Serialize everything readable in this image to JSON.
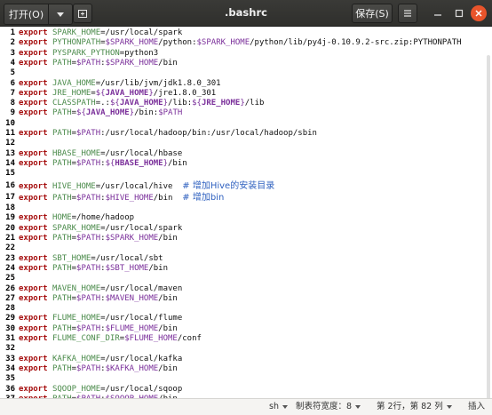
{
  "header": {
    "open_label": "打开(O)",
    "title": ".bashrc",
    "save_label": "保存(S)"
  },
  "status": {
    "language": "sh",
    "tab_width": "制表符宽度：8",
    "position": "第 2行，第 82 列",
    "mode": "插入"
  },
  "colors": {
    "keyword": "#a50d0d",
    "variable": "#4a8a4a",
    "expansion": "#7a2f9a",
    "comment": "#2d5fbf",
    "close_button": "#e9542b"
  },
  "lines": [
    {
      "n": "1",
      "parts": [
        [
          "kw",
          "export"
        ],
        [
          "plain",
          " "
        ],
        [
          "var",
          "SPARK_HOME"
        ],
        [
          "plain",
          "=/usr/local/spark"
        ]
      ]
    },
    {
      "n": "2",
      "parts": [
        [
          "kw",
          "export"
        ],
        [
          "plain",
          " "
        ],
        [
          "var",
          "PYTHONPATH"
        ],
        [
          "plain",
          "="
        ],
        [
          "exp",
          "$SPARK_HOME"
        ],
        [
          "plain",
          "/python:"
        ],
        [
          "exp",
          "$SPARK_HOME"
        ],
        [
          "plain",
          "/python/lib/py4j-0.10.9.2-src.zip:PYTHONPATH"
        ]
      ]
    },
    {
      "n": "3",
      "parts": [
        [
          "kw",
          "export"
        ],
        [
          "plain",
          " "
        ],
        [
          "var",
          "PYSPARK_PYTHON"
        ],
        [
          "plain",
          "=python3"
        ]
      ]
    },
    {
      "n": "4",
      "parts": [
        [
          "kw",
          "export"
        ],
        [
          "plain",
          " "
        ],
        [
          "var",
          "PATH"
        ],
        [
          "plain",
          "="
        ],
        [
          "exp",
          "$PATH"
        ],
        [
          "plain",
          ":"
        ],
        [
          "exp",
          "$SPARK_HOME"
        ],
        [
          "plain",
          "/bin"
        ]
      ]
    },
    {
      "n": "5",
      "parts": []
    },
    {
      "n": "6",
      "parts": [
        [
          "kw",
          "export"
        ],
        [
          "plain",
          " "
        ],
        [
          "var",
          "JAVA_HOME"
        ],
        [
          "plain",
          "=/usr/lib/jvm/jdk1.8.0_301"
        ]
      ]
    },
    {
      "n": "7",
      "parts": [
        [
          "kw",
          "export"
        ],
        [
          "plain",
          " "
        ],
        [
          "var",
          "JRE_HOME"
        ],
        [
          "plain",
          "="
        ],
        [
          "exp",
          "${"
        ],
        [
          "expb",
          "JAVA_HOME"
        ],
        [
          "exp",
          "}"
        ],
        [
          "plain",
          "/jre1.8.0_301"
        ]
      ]
    },
    {
      "n": "8",
      "parts": [
        [
          "kw",
          "export"
        ],
        [
          "plain",
          " "
        ],
        [
          "var",
          "CLASSPATH"
        ],
        [
          "plain",
          "=.:"
        ],
        [
          "exp",
          "${"
        ],
        [
          "expb",
          "JAVA_HOME"
        ],
        [
          "exp",
          "}"
        ],
        [
          "plain",
          "/lib:"
        ],
        [
          "exp",
          "${"
        ],
        [
          "expb",
          "JRE_HOME"
        ],
        [
          "exp",
          "}"
        ],
        [
          "plain",
          "/lib"
        ]
      ]
    },
    {
      "n": "9",
      "parts": [
        [
          "kw",
          "export"
        ],
        [
          "plain",
          " "
        ],
        [
          "var",
          "PATH"
        ],
        [
          "plain",
          "="
        ],
        [
          "exp",
          "${"
        ],
        [
          "expb",
          "JAVA_HOME"
        ],
        [
          "exp",
          "}"
        ],
        [
          "plain",
          "/bin:"
        ],
        [
          "exp",
          "$PATH"
        ]
      ]
    },
    {
      "n": "10",
      "parts": []
    },
    {
      "n": "11",
      "parts": [
        [
          "kw",
          "export"
        ],
        [
          "plain",
          " "
        ],
        [
          "var",
          "PATH"
        ],
        [
          "plain",
          "="
        ],
        [
          "exp",
          "$PATH"
        ],
        [
          "plain",
          ":/usr/local/hadoop/bin:/usr/local/hadoop/sbin"
        ]
      ]
    },
    {
      "n": "12",
      "parts": []
    },
    {
      "n": "13",
      "parts": [
        [
          "kw",
          "export"
        ],
        [
          "plain",
          " "
        ],
        [
          "var",
          "HBASE_HOME"
        ],
        [
          "plain",
          "=/usr/local/hbase"
        ]
      ]
    },
    {
      "n": "14",
      "parts": [
        [
          "kw",
          "export"
        ],
        [
          "plain",
          " "
        ],
        [
          "var",
          "PATH"
        ],
        [
          "plain",
          "="
        ],
        [
          "exp",
          "$PATH"
        ],
        [
          "plain",
          ":"
        ],
        [
          "exp",
          "${"
        ],
        [
          "expb",
          "HBASE_HOME"
        ],
        [
          "exp",
          "}"
        ],
        [
          "plain",
          "/bin"
        ]
      ]
    },
    {
      "n": "15",
      "parts": []
    },
    {
      "n": "16",
      "parts": [
        [
          "kw",
          "export"
        ],
        [
          "plain",
          " "
        ],
        [
          "var",
          "HIVE_HOME"
        ],
        [
          "plain",
          "=/usr/local/hive  "
        ],
        [
          "comment",
          "# 增加Hive的安装目录"
        ]
      ]
    },
    {
      "n": "17",
      "parts": [
        [
          "kw",
          "export"
        ],
        [
          "plain",
          " "
        ],
        [
          "var",
          "PATH"
        ],
        [
          "plain",
          "="
        ],
        [
          "exp",
          "$PATH"
        ],
        [
          "plain",
          ":"
        ],
        [
          "exp",
          "$HIVE_HOME"
        ],
        [
          "plain",
          "/bin  "
        ],
        [
          "comment",
          "# 增加bin"
        ]
      ]
    },
    {
      "n": "18",
      "parts": []
    },
    {
      "n": "19",
      "parts": [
        [
          "kw",
          "export"
        ],
        [
          "plain",
          " "
        ],
        [
          "var",
          "HOME"
        ],
        [
          "plain",
          "=/home/hadoop"
        ]
      ]
    },
    {
      "n": "20",
      "parts": [
        [
          "kw",
          "export"
        ],
        [
          "plain",
          " "
        ],
        [
          "var",
          "SPARK_HOME"
        ],
        [
          "plain",
          "=/usr/local/spark"
        ]
      ]
    },
    {
      "n": "21",
      "parts": [
        [
          "kw",
          "export"
        ],
        [
          "plain",
          " "
        ],
        [
          "var",
          "PATH"
        ],
        [
          "plain",
          "="
        ],
        [
          "exp",
          "$PATH"
        ],
        [
          "plain",
          ":"
        ],
        [
          "exp",
          "$SPARK_HOME"
        ],
        [
          "plain",
          "/bin"
        ]
      ]
    },
    {
      "n": "22",
      "parts": []
    },
    {
      "n": "23",
      "parts": [
        [
          "kw",
          "export"
        ],
        [
          "plain",
          " "
        ],
        [
          "var",
          "SBT_HOME"
        ],
        [
          "plain",
          "=/usr/local/sbt"
        ]
      ]
    },
    {
      "n": "24",
      "parts": [
        [
          "kw",
          "export"
        ],
        [
          "plain",
          " "
        ],
        [
          "var",
          "PATH"
        ],
        [
          "plain",
          "="
        ],
        [
          "exp",
          "$PATH"
        ],
        [
          "plain",
          ":"
        ],
        [
          "exp",
          "$SBT_HOME"
        ],
        [
          "plain",
          "/bin"
        ]
      ]
    },
    {
      "n": "25",
      "parts": []
    },
    {
      "n": "26",
      "parts": [
        [
          "kw",
          "export"
        ],
        [
          "plain",
          " "
        ],
        [
          "var",
          "MAVEN_HOME"
        ],
        [
          "plain",
          "=/usr/local/maven"
        ]
      ]
    },
    {
      "n": "27",
      "parts": [
        [
          "kw",
          "export"
        ],
        [
          "plain",
          " "
        ],
        [
          "var",
          "PATH"
        ],
        [
          "plain",
          "="
        ],
        [
          "exp",
          "$PATH"
        ],
        [
          "plain",
          ":"
        ],
        [
          "exp",
          "$MAVEN_HOME"
        ],
        [
          "plain",
          "/bin"
        ]
      ]
    },
    {
      "n": "28",
      "parts": []
    },
    {
      "n": "29",
      "parts": [
        [
          "kw",
          "export"
        ],
        [
          "plain",
          " "
        ],
        [
          "var",
          "FLUME_HOME"
        ],
        [
          "plain",
          "=/usr/local/flume"
        ]
      ]
    },
    {
      "n": "30",
      "parts": [
        [
          "kw",
          "export"
        ],
        [
          "plain",
          " "
        ],
        [
          "var",
          "PATH"
        ],
        [
          "plain",
          "="
        ],
        [
          "exp",
          "$PATH"
        ],
        [
          "plain",
          ":"
        ],
        [
          "exp",
          "$FLUME_HOME"
        ],
        [
          "plain",
          "/bin"
        ]
      ]
    },
    {
      "n": "31",
      "parts": [
        [
          "kw",
          "export"
        ],
        [
          "plain",
          " "
        ],
        [
          "var",
          "FLUME_CONF_DIR"
        ],
        [
          "plain",
          "="
        ],
        [
          "exp",
          "$FLUME_HOME"
        ],
        [
          "plain",
          "/conf"
        ]
      ]
    },
    {
      "n": "32",
      "parts": []
    },
    {
      "n": "33",
      "parts": [
        [
          "kw",
          "export"
        ],
        [
          "plain",
          " "
        ],
        [
          "var",
          "KAFKA_HOME"
        ],
        [
          "plain",
          "=/usr/local/kafka"
        ]
      ]
    },
    {
      "n": "34",
      "parts": [
        [
          "kw",
          "export"
        ],
        [
          "plain",
          " "
        ],
        [
          "var",
          "PATH"
        ],
        [
          "plain",
          "="
        ],
        [
          "exp",
          "$PATH"
        ],
        [
          "plain",
          ":"
        ],
        [
          "exp",
          "$KAFKA_HOME"
        ],
        [
          "plain",
          "/bin"
        ]
      ]
    },
    {
      "n": "35",
      "parts": []
    },
    {
      "n": "36",
      "parts": [
        [
          "kw",
          "export"
        ],
        [
          "plain",
          " "
        ],
        [
          "var",
          "SQOOP_HOME"
        ],
        [
          "plain",
          "=/usr/local/sqoop"
        ]
      ]
    },
    {
      "n": "37",
      "parts": [
        [
          "kw",
          "export"
        ],
        [
          "plain",
          " "
        ],
        [
          "var",
          "PATH"
        ],
        [
          "plain",
          "="
        ],
        [
          "exp",
          "$PATH"
        ],
        [
          "plain",
          ":"
        ],
        [
          "exp",
          "$SQOOP_HOME"
        ],
        [
          "plain",
          "/bin"
        ]
      ]
    }
  ]
}
